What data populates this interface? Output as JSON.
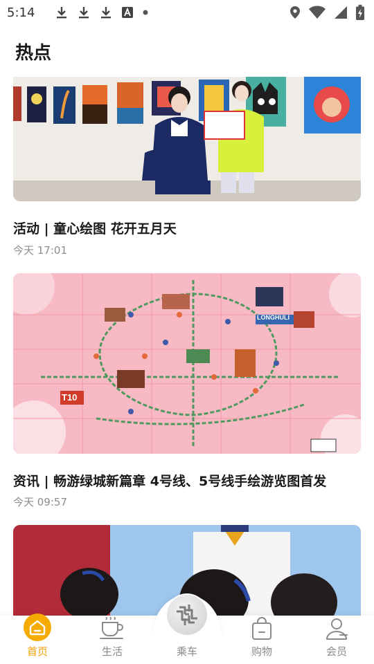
{
  "status_bar": {
    "time": "5:14",
    "notification_icons": [
      "download-icon",
      "download-icon",
      "download-icon",
      "a-icon",
      "dot-icon"
    ],
    "system_icons": [
      "location-icon",
      "wifi-icon",
      "signal-icon",
      "battery-icon"
    ]
  },
  "page": {
    "title": "热点"
  },
  "feed": [
    {
      "title": "活动 | 童心绘图 花开五月天",
      "time": "今天 17:01",
      "image": "gallery-photo"
    },
    {
      "title": "资讯 | 畅游绿城新篇章 4号线、5号线手绘游览图首发",
      "time": "今天 09:57",
      "image": "metro-map-illustration",
      "map_badge": "T10",
      "map_station": "LONGHULI"
    },
    {
      "title": "",
      "time": "",
      "image": "staff-photo"
    }
  ],
  "bottom_nav": {
    "items": [
      {
        "label": "首页",
        "icon": "home-icon",
        "active": true
      },
      {
        "label": "生活",
        "icon": "coffee-cup-icon",
        "active": false
      },
      {
        "label": "乘车",
        "icon": "metro-logo-icon",
        "active": false
      },
      {
        "label": "购物",
        "icon": "shopping-bag-icon",
        "active": false
      },
      {
        "label": "会员",
        "icon": "user-icon",
        "active": false
      }
    ],
    "active_color": "#f4a100",
    "inactive_color": "#8a8a8a"
  }
}
